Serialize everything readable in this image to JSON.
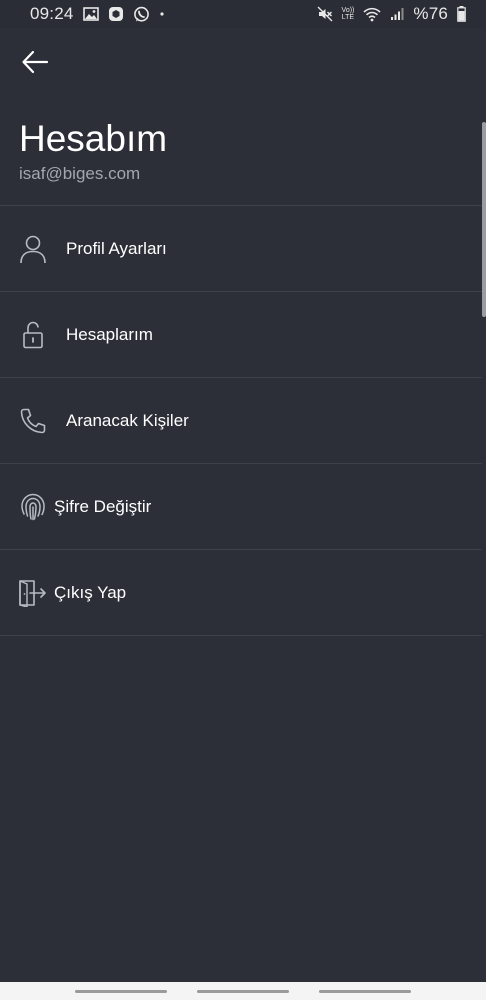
{
  "status_bar": {
    "time": "09:24",
    "volte_top": "Vo))",
    "volte_bottom": "LTE",
    "battery_text": "%76",
    "icons": [
      "gallery-icon",
      "app-notification-icon",
      "whatsapp-icon",
      "dot-icon",
      "mute-icon",
      "volte-icon",
      "wifi-icon",
      "signal-icon",
      "battery-icon"
    ]
  },
  "header": {
    "back_icon": "arrow-left-icon",
    "title": "Hesabım",
    "email": "isaf@biges.com"
  },
  "menu": {
    "items": [
      {
        "label": "Profil Ayarları",
        "icon": "user-icon"
      },
      {
        "label": "Hesaplarım",
        "icon": "unlock-icon"
      },
      {
        "label": "Aranacak Kişiler",
        "icon": "phone-icon"
      },
      {
        "label": "Şifre Değiştir",
        "icon": "fingerprint-icon"
      },
      {
        "label": "Çıkış Yap",
        "icon": "logout-icon"
      }
    ]
  },
  "colors": {
    "background": "#2c2f38",
    "divider": "#3d414b",
    "text": "#ffffff",
    "secondary_text": "#a3a6ad",
    "icon_stroke": "#b8bbc2"
  }
}
